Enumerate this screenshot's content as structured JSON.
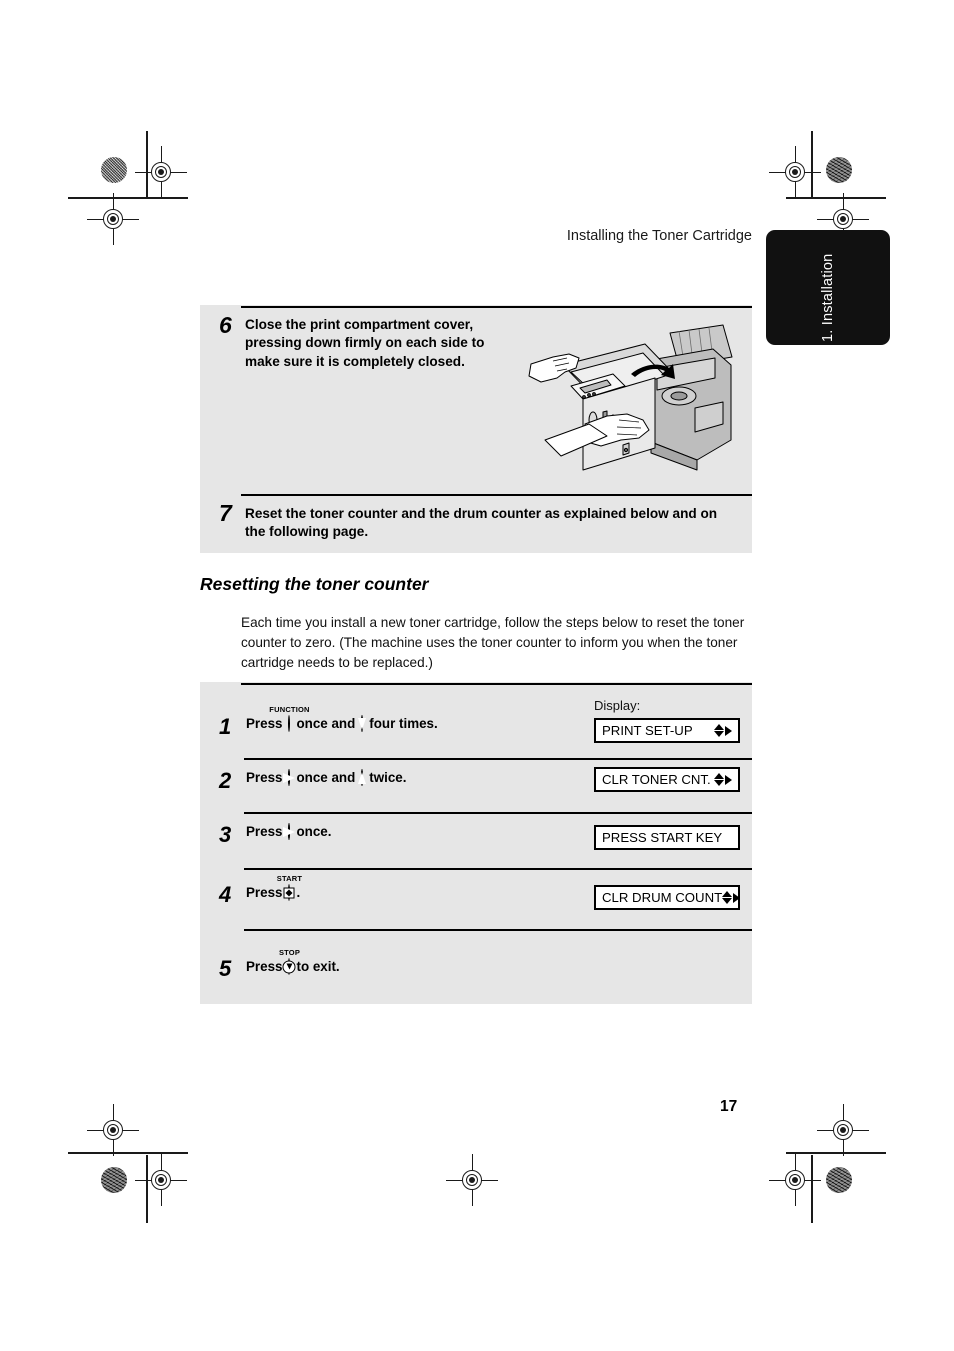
{
  "document": {
    "running_head": "Installing the Toner Cartridge",
    "side_tab": "1. Installation",
    "page_number": "17"
  },
  "steps_panel": {
    "step6": {
      "number": "6",
      "text": "Close the print compartment cover, pressing down firmly on each side to make sure it is completely closed.",
      "illustration": "printer-closing-cover-illustration"
    },
    "step7": {
      "number": "7",
      "text": "Reset the toner counter and the drum counter as explained below and on the following page."
    }
  },
  "section": {
    "heading": "Resetting the toner counter",
    "intro": "Each time you install a new toner cartridge, follow the steps below to reset the toner counter to zero. (The machine uses the toner counter to inform you when the toner cartridge needs to be replaced.)"
  },
  "procedure": {
    "display_label": "Display:",
    "rows": [
      {
        "number": "1",
        "press_label": "Press",
        "key1": {
          "cap": "FUNCTION",
          "icon": "function-key-icon"
        },
        "mid_text": "once and",
        "key2": {
          "cap": "",
          "icon": "down-arrow-key-icon"
        },
        "tail_text": "four times.",
        "display": {
          "text": "PRINT SET-UP",
          "arrows": "up-down-right"
        }
      },
      {
        "number": "2",
        "press_label": "Press",
        "key1": {
          "cap": "",
          "icon": "right-arrow-key-icon"
        },
        "mid_text": "once and",
        "key2": {
          "cap": "",
          "icon": "up-arrow-key-icon"
        },
        "tail_text": "twice.",
        "display": {
          "text": "CLR TONER CNT.",
          "arrows": "up-down-right"
        }
      },
      {
        "number": "3",
        "press_label": "Press",
        "key1": {
          "cap": "",
          "icon": "right-arrow-key-icon"
        },
        "mid_text": "",
        "key2": null,
        "tail_text": "once.",
        "display": {
          "text": "PRESS START KEY",
          "arrows": "none"
        }
      },
      {
        "number": "4",
        "press_label": "Press",
        "key1": {
          "cap": "START",
          "icon": "start-key-icon"
        },
        "mid_text": "",
        "key2": null,
        "tail_text": ".",
        "display": {
          "text": "CLR DRUM COUNT",
          "arrows": "up-down-right"
        }
      },
      {
        "number": "5",
        "press_label": "Press",
        "key1": {
          "cap": "STOP",
          "icon": "stop-key-icon"
        },
        "mid_text": "",
        "key2": null,
        "tail_text": "to exit.",
        "display": null
      }
    ]
  },
  "colors": {
    "panel_gray": "#e6e6e6",
    "tab_black": "#111111",
    "text_black": "#000000",
    "page_white": "#ffffff"
  }
}
